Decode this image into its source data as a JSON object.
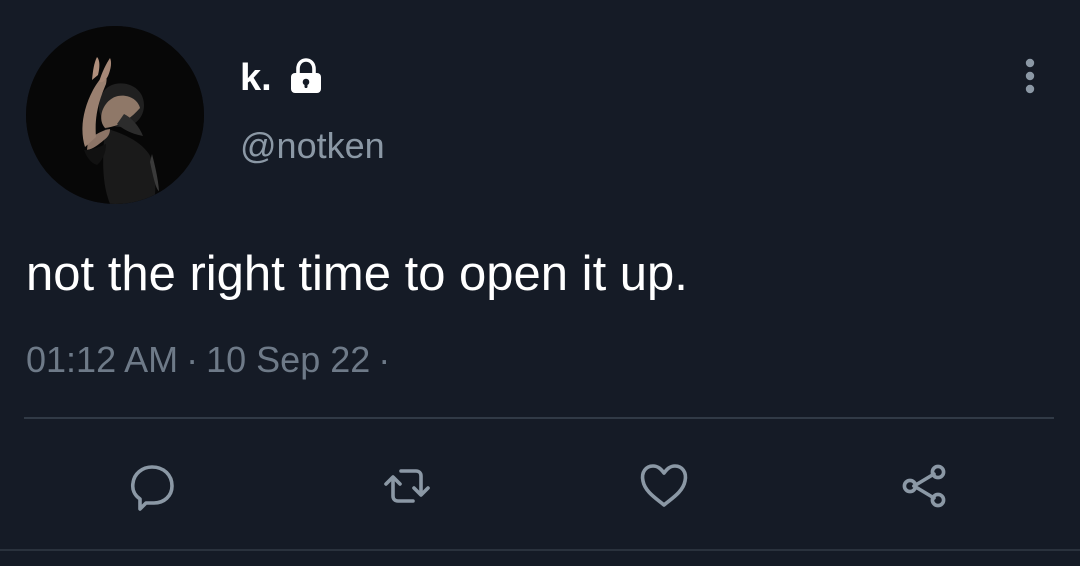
{
  "tweet": {
    "display_name": "k.",
    "handle": "@notken",
    "text": "not the right time to open it up.",
    "time": "01:12 AM",
    "date": "10 Sep 22",
    "separator": "·"
  },
  "colors": {
    "background": "#151b26",
    "primary_text": "#ffffff",
    "secondary_text": "#8b98a5",
    "divider": "#313a46"
  },
  "icons": {
    "lock": "lock-icon",
    "more": "more-vertical-icon",
    "reply": "reply-icon",
    "retweet": "retweet-icon",
    "like": "heart-icon",
    "share": "share-icon"
  }
}
